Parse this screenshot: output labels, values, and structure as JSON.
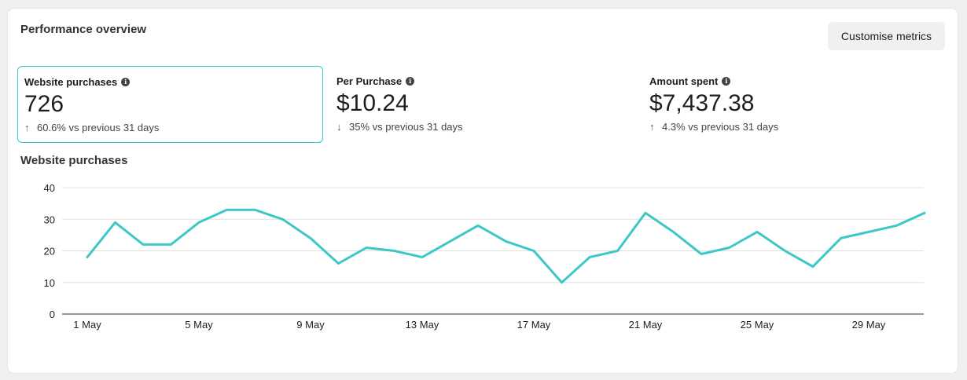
{
  "header": {
    "title": "Performance overview",
    "customise_label": "Customise metrics"
  },
  "metrics": [
    {
      "label": "Website purchases",
      "value": "726",
      "direction": "up",
      "change": "60.6% vs previous 31 days",
      "selected": true
    },
    {
      "label": "Per Purchase",
      "value": "$10.24",
      "direction": "down",
      "change": "35% vs previous 31 days",
      "selected": false
    },
    {
      "label": "Amount spent",
      "value": "$7,437.38",
      "direction": "up",
      "change": "4.3% vs previous 31 days",
      "selected": false
    }
  ],
  "colors": {
    "line": "#3ec7c7",
    "grid": "#e0e0e0",
    "selected_border": "#3ec7c7"
  },
  "chart_data": {
    "type": "line",
    "title": "Website purchases",
    "x": [
      "1 May",
      "2 May",
      "3 May",
      "4 May",
      "5 May",
      "6 May",
      "7 May",
      "8 May",
      "9 May",
      "10 May",
      "11 May",
      "12 May",
      "13 May",
      "14 May",
      "15 May",
      "16 May",
      "17 May",
      "18 May",
      "19 May",
      "20 May",
      "21 May",
      "22 May",
      "23 May",
      "24 May",
      "25 May",
      "26 May",
      "27 May",
      "28 May",
      "29 May",
      "30 May",
      "31 May"
    ],
    "x_tick_labels": [
      "1 May",
      "5 May",
      "9 May",
      "13 May",
      "17 May",
      "21 May",
      "25 May",
      "29 May"
    ],
    "series": [
      {
        "values": [
          18,
          29,
          22,
          22,
          29,
          33,
          33,
          30,
          24,
          16,
          21,
          20,
          18,
          23,
          28,
          23,
          20,
          10,
          18,
          20,
          32,
          26,
          19,
          21,
          26,
          20,
          15,
          24,
          26,
          28,
          32
        ]
      }
    ],
    "ylim": [
      0,
      40
    ],
    "yticks": [
      0,
      10,
      20,
      30,
      40
    ],
    "grid": true,
    "legend": "none"
  }
}
